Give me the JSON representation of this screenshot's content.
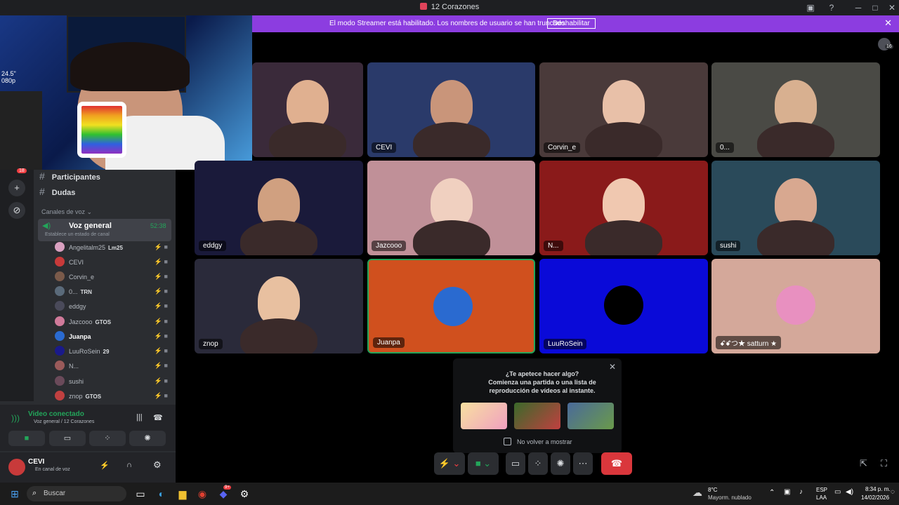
{
  "window": {
    "title": "12 Corazones"
  },
  "banner": {
    "text": "El modo Streamer está habilitado. Los nombres de usuario se han truncado.",
    "button": "Deshabilitar"
  },
  "participants_badge": "16",
  "rail_badge": "18",
  "sidebar": {
    "channels": [
      "Participantes",
      "Dudas"
    ],
    "voice_header": "Canales de voz",
    "voice_channel": {
      "name": "Voz general",
      "timer": "52:38",
      "status": "Establece un estado de canal"
    },
    "members": [
      {
        "name": "Angelitalm25",
        "tag": "Lm25",
        "color": "#d9a0c0"
      },
      {
        "name": "CEVI",
        "tag": "",
        "color": "#c83a3a"
      },
      {
        "name": "Corvin_e",
        "tag": "",
        "color": "#7a5a4a"
      },
      {
        "name": "0...",
        "tag": "TRN",
        "color": "#5a6a7a"
      },
      {
        "name": "eddgy",
        "tag": "",
        "color": "#4a4a5a"
      },
      {
        "name": "Jazcooo",
        "tag": "GTOS",
        "color": "#d07a9a"
      },
      {
        "name": "Juanpa",
        "tag": "",
        "color": "#2a6ad0"
      },
      {
        "name": "LuuRoSein",
        "tag": "29",
        "color": "#1a1a8a"
      },
      {
        "name": "N...",
        "tag": "",
        "color": "#9a5a5a"
      },
      {
        "name": "sushi",
        "tag": "",
        "color": "#6a4a5a"
      },
      {
        "name": "znop",
        "tag": "GTOS",
        "color": "#c04040"
      }
    ]
  },
  "voice_panel": {
    "status": "Video conectado",
    "location": "Voz general / 12 Corazones"
  },
  "user_panel": {
    "name": "CEVI",
    "status": "En canal de voz"
  },
  "tiles": [
    {
      "label": "",
      "bg": "#3a2a3a"
    },
    {
      "label": "CEVI",
      "bg": "#2a3a6a"
    },
    {
      "label": "Corvin_e",
      "bg": "#4a3a3a"
    },
    {
      "label": "0...",
      "bg": "#4a4a45"
    },
    {
      "label": "eddgy",
      "bg": "#1a1a3a"
    },
    {
      "label": "Jazcooo",
      "bg": "#c09098"
    },
    {
      "label": "N...",
      "bg": "#8a1a1a"
    },
    {
      "label": "sushi",
      "bg": "#2a4a5a"
    },
    {
      "label": "znop",
      "bg": "#2a2a3a"
    },
    {
      "label": "Juanpa",
      "bg": "#d0501e"
    },
    {
      "label": "LuuRoSein",
      "bg": "#0a0ad8"
    },
    {
      "label": "ꗃꗄつ★ satturn ★",
      "bg": "#d4a89a"
    }
  ],
  "popup": {
    "line1": "¿Te apetece hacer algo?",
    "line2": "Comienza una partida o una lista de",
    "line3": "reproducción de vídeos al instante.",
    "checkbox": "No volver a mostrar"
  },
  "stream_overlay": {
    "setup_text": "24.5\"",
    "setup_text2": "080p"
  },
  "taskbar": {
    "search": "Buscar",
    "weather_temp": "8°C",
    "weather_desc": "Mayorm. nublado",
    "lang1": "ESP",
    "lang2": "LAA",
    "time": "8:34 p. m.",
    "date": "14/02/2026",
    "discord_badge": "9+"
  }
}
